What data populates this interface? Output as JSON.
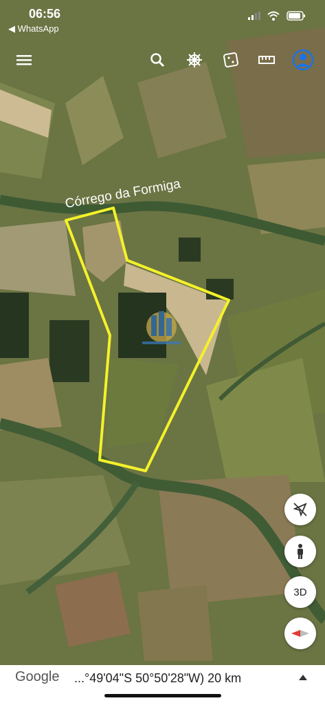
{
  "status_bar": {
    "time": "06:56",
    "back_label": "◀ WhatsApp"
  },
  "toolbar": {
    "icons": [
      "menu-icon",
      "search-icon",
      "voyager-wheel-icon",
      "feeling-lucky-dice-icon",
      "measure-ruler-icon",
      "account-icon"
    ]
  },
  "map": {
    "river_label": "Córrego da Formiga",
    "boundary_color": "#f4f12a",
    "watermark_icon": "real-estate-logo-icon"
  },
  "controls": {
    "three_d_label": "3D",
    "icons": [
      "location-arrow-icon",
      "street-view-person-icon",
      "compass-icon"
    ]
  },
  "bottom_bar": {
    "brand": "Google",
    "coordinates": "...°49'04\"S 50°50'28\"W) 20 km"
  }
}
